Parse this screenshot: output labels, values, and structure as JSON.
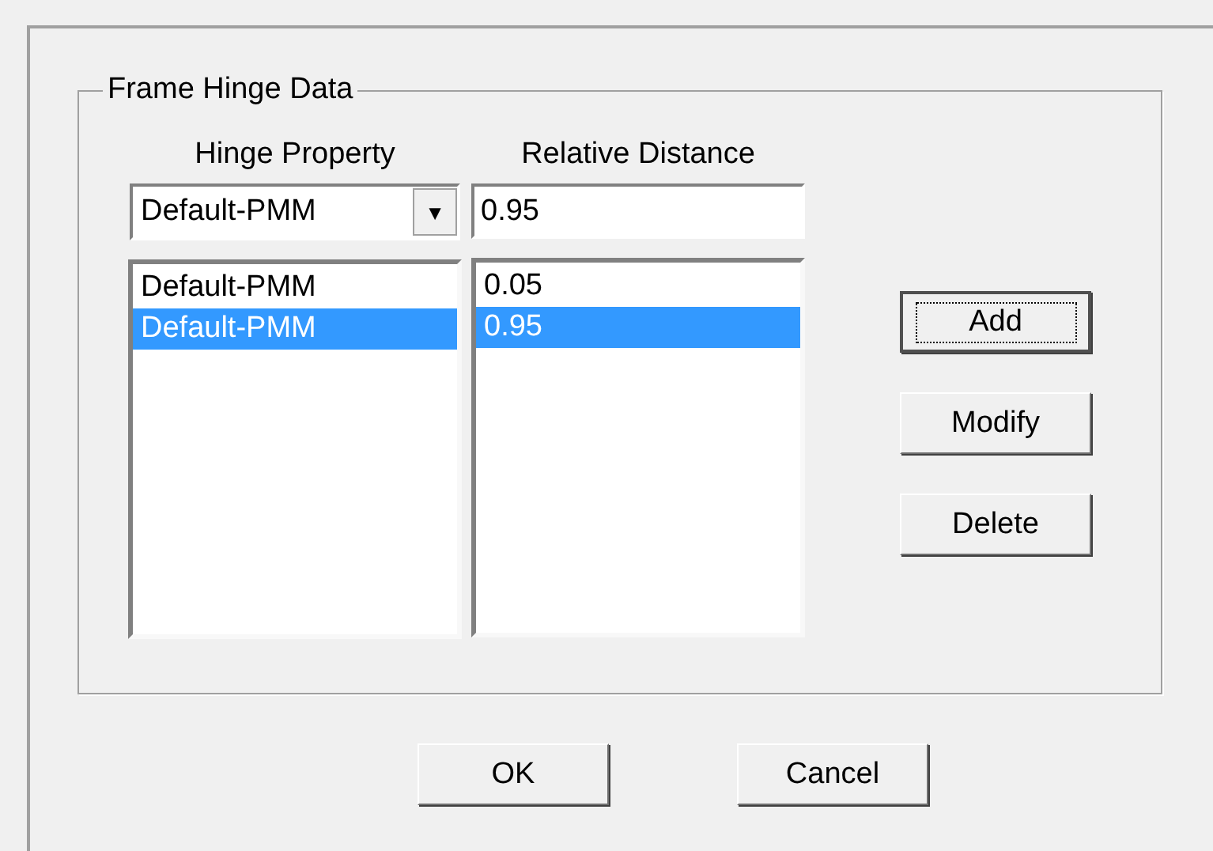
{
  "group": {
    "title": "Frame Hinge Data"
  },
  "hinge_property": {
    "label": "Hinge Property",
    "value": "Default-PMM",
    "dropdown_arrow": "▼"
  },
  "relative_distance": {
    "label": "Relative Distance",
    "value": "0.95"
  },
  "hinge_list": [
    {
      "text": "Default-PMM",
      "selected": false
    },
    {
      "text": "Default-PMM",
      "selected": true
    }
  ],
  "distance_list": [
    {
      "text": "0.05",
      "selected": false
    },
    {
      "text": "0.95",
      "selected": true
    }
  ],
  "side_buttons": [
    {
      "label": "Add",
      "default": true
    },
    {
      "label": "Modify",
      "default": false
    },
    {
      "label": "Delete",
      "default": false
    }
  ],
  "buttons": [
    {
      "label": "OK"
    },
    {
      "label": "Cancel"
    }
  ]
}
